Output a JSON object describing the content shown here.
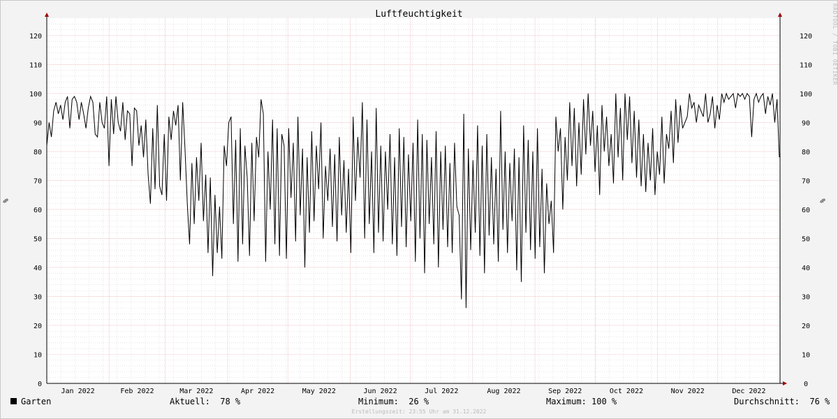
{
  "watermark": "RRDTOOL / TOBI OETIKER",
  "legend": {
    "series_name": "Garten",
    "current_label": "Aktuell:",
    "current_value": "78 %",
    "min_label": "Minimum:",
    "min_value": "26 %",
    "max_label": "Maximum:",
    "max_value": "100 %",
    "avg_label": "Durchschnitt:",
    "avg_value": "76 %"
  },
  "footer": "Erstellungszeit: 23:55 Uhr am 31.12.2022",
  "chart_data": {
    "type": "line",
    "title": "Luftfeuchtigkeit",
    "ylabel": "%",
    "ylim": [
      0,
      126
    ],
    "yticks": [
      0,
      10,
      20,
      30,
      40,
      50,
      60,
      70,
      80,
      90,
      100,
      110,
      120
    ],
    "months": [
      "Jan 2022",
      "Feb 2022",
      "Mar 2022",
      "Apr 2022",
      "May 2022",
      "Jun 2022",
      "Jul 2022",
      "Aug 2022",
      "Sep 2022",
      "Oct 2022",
      "Nov 2022",
      "Dec 2022"
    ],
    "grid": true,
    "colors": {
      "line": "#000000",
      "grid_major": "#e8a0a0",
      "grid_minor": "#cccccc",
      "axis": "#000000",
      "arrow": "#a00000"
    },
    "series": [
      {
        "name": "Garten",
        "period": "2022-01-01 to 2022-12-31, twice daily",
        "values": [
          82,
          90,
          85,
          94,
          97,
          93,
          96,
          91,
          97,
          99,
          88,
          98,
          99,
          97,
          91,
          97,
          93,
          88,
          95,
          99,
          97,
          86,
          85,
          97,
          90,
          88,
          99,
          75,
          98,
          86,
          99,
          90,
          87,
          97,
          84,
          94,
          93,
          75,
          95,
          94,
          82,
          89,
          78,
          91,
          72,
          62,
          88,
          67,
          96,
          68,
          65,
          86,
          63,
          92,
          84,
          94,
          89,
          96,
          70,
          97,
          81,
          62,
          48,
          76,
          55,
          78,
          63,
          83,
          56,
          72,
          45,
          71,
          37,
          65,
          45,
          61,
          43,
          82,
          75,
          90,
          92,
          55,
          84,
          42,
          88,
          48,
          82,
          71,
          44,
          83,
          56,
          85,
          78,
          98,
          93,
          42,
          80,
          60,
          91,
          48,
          88,
          44,
          86,
          82,
          43,
          88,
          64,
          83,
          49,
          92,
          58,
          81,
          40,
          78,
          52,
          87,
          56,
          82,
          67,
          90,
          50,
          75,
          63,
          81,
          54,
          79,
          49,
          85,
          58,
          77,
          52,
          74,
          45,
          92,
          63,
          85,
          71,
          97,
          50,
          91,
          55,
          80,
          45,
          95,
          52,
          82,
          49,
          80,
          60,
          86,
          48,
          78,
          44,
          88,
          54,
          85,
          47,
          79,
          56,
          83,
          42,
          91,
          50,
          86,
          38,
          84,
          55,
          78,
          48,
          87,
          40,
          80,
          53,
          82,
          47,
          76,
          45,
          83,
          61,
          58,
          29,
          93,
          26,
          81,
          46,
          77,
          52,
          89,
          44,
          82,
          38,
          86,
          51,
          78,
          48,
          74,
          42,
          94,
          53,
          80,
          45,
          76,
          56,
          81,
          39,
          78,
          35,
          89,
          52,
          84,
          46,
          80,
          43,
          88,
          47,
          74,
          38,
          69,
          55,
          63,
          45,
          92,
          80,
          88,
          60,
          85,
          70,
          97,
          75,
          95,
          68,
          90,
          72,
          98,
          79,
          100,
          82,
          94,
          73,
          89,
          65,
          96,
          80,
          92,
          75,
          86,
          69,
          100,
          78,
          95,
          70,
          100,
          84,
          99,
          76,
          94,
          71,
          91,
          68,
          86,
          66,
          83,
          70,
          88,
          65,
          80,
          72,
          92,
          69,
          86,
          81,
          94,
          76,
          98,
          83,
          96,
          88,
          90,
          92,
          100,
          95,
          97,
          90,
          96,
          94,
          92,
          100,
          90,
          93,
          99,
          88,
          96,
          91,
          100,
          97,
          100,
          98,
          99,
          100,
          95,
          100,
          99,
          100,
          98,
          100,
          99,
          85,
          98,
          100,
          97,
          99,
          100,
          93,
          99,
          96,
          100,
          90,
          98,
          78
        ]
      }
    ]
  }
}
